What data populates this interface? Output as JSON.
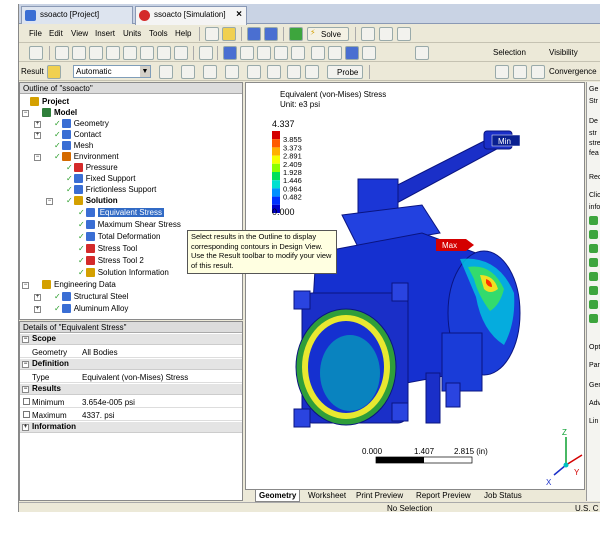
{
  "doc_tabs": [
    {
      "label": "ssoacto [Project]",
      "active": false
    },
    {
      "label": "ssoacto [Simulation]",
      "active": true
    }
  ],
  "menu": [
    "File",
    "Edit",
    "View",
    "Insert",
    "Units",
    "Tools",
    "Help"
  ],
  "toolbar": {
    "solve_label": "Solve",
    "selection_label": "Selection",
    "visibility_label": "Visibility",
    "result_label": "Result",
    "scale_value": "Automatic",
    "probe_label": "Probe",
    "convergence_label": "Convergence"
  },
  "outline": {
    "header": "Outline of \"ssoacto\"",
    "items": [
      {
        "label": "Project",
        "indent": 0,
        "bold": true,
        "icon": "project-icon"
      },
      {
        "label": "Model",
        "indent": 1,
        "bold": true,
        "icon": "model-icon"
      },
      {
        "label": "Geometry",
        "indent": 2,
        "icon": "geometry-icon"
      },
      {
        "label": "Contact",
        "indent": 2,
        "icon": "contact-icon"
      },
      {
        "label": "Mesh",
        "indent": 2,
        "icon": "mesh-icon"
      },
      {
        "label": "Environment",
        "indent": 2,
        "icon": "environment-icon"
      },
      {
        "label": "Pressure",
        "indent": 3,
        "icon": "pressure-icon"
      },
      {
        "label": "Fixed Support",
        "indent": 3,
        "icon": "fixed-support-icon"
      },
      {
        "label": "Frictionless Support",
        "indent": 3,
        "icon": "frictionless-support-icon"
      },
      {
        "label": "Solution",
        "indent": 3,
        "bold": true,
        "icon": "solution-icon"
      },
      {
        "label": "Equivalent Stress",
        "indent": 4,
        "icon": "result-icon",
        "selected": true
      },
      {
        "label": "Maximum Shear Stress",
        "indent": 4,
        "icon": "result-icon"
      },
      {
        "label": "Total Deformation",
        "indent": 4,
        "icon": "result-icon"
      },
      {
        "label": "Stress Tool",
        "indent": 4,
        "icon": "tool-icon"
      },
      {
        "label": "Stress Tool 2",
        "indent": 4,
        "icon": "tool-icon"
      },
      {
        "label": "Solution Information",
        "indent": 4,
        "icon": "info-icon"
      },
      {
        "label": "Engineering Data",
        "indent": 1,
        "icon": "data-icon"
      },
      {
        "label": "Structural Steel",
        "indent": 2,
        "icon": "material-icon"
      },
      {
        "label": "Aluminum Alloy",
        "indent": 2,
        "icon": "material-icon"
      }
    ]
  },
  "details": {
    "header": "Details of \"Equivalent Stress\"",
    "groups": {
      "scope": "Scope",
      "definition": "Definition",
      "results": "Results",
      "information": "Information"
    },
    "scope_key": "Geometry",
    "scope_value": "All Bodies",
    "definition_key": "Type",
    "definition_value": "Equivalent (von-Mises) Stress",
    "min_key": "Minimum",
    "min_value": "3.654e-005 psi",
    "max_key": "Maximum",
    "max_value": "4337. psi"
  },
  "tooltip": {
    "text": "Select results in the Outline to display corresponding contours in Design View. Use the Result toolbar to modify your view of this result."
  },
  "legend": {
    "title_line1": "Equivalent (von-Mises) Stress",
    "title_line2": "Unit: e3 psi",
    "max_label": "4.337",
    "values": [
      "3.855",
      "3.373",
      "2.891",
      "2.409",
      "1.928",
      "1.446",
      "0.964",
      "0.482"
    ],
    "min_label": "0.000",
    "colors": [
      "#d40000",
      "#ff5a00",
      "#ffb000",
      "#f5ff00",
      "#8cff00",
      "#00e05a",
      "#00e0d0",
      "#0090ff",
      "#0030ff",
      "#0000c8"
    ]
  },
  "markers": {
    "min_label": "Min",
    "max_label": "Max"
  },
  "scale_bar": {
    "left": "0.000",
    "mid": "1.407",
    "right": "2.815 (in)"
  },
  "axes": {
    "x": "X",
    "y": "Y",
    "z": "Z"
  },
  "bottom_tabs": [
    "Geometry",
    "Worksheet",
    "Print Preview",
    "Report Preview",
    "Job Status"
  ],
  "status": {
    "selection": "No Selection",
    "units": "U.S. C"
  },
  "right_panel": {
    "items": [
      "Ge",
      "Str",
      "De",
      "str",
      "stre",
      "fea",
      "Red",
      "Clic",
      "info",
      "Opt",
      "Par",
      "Gen",
      "Adv",
      "Lin"
    ]
  }
}
